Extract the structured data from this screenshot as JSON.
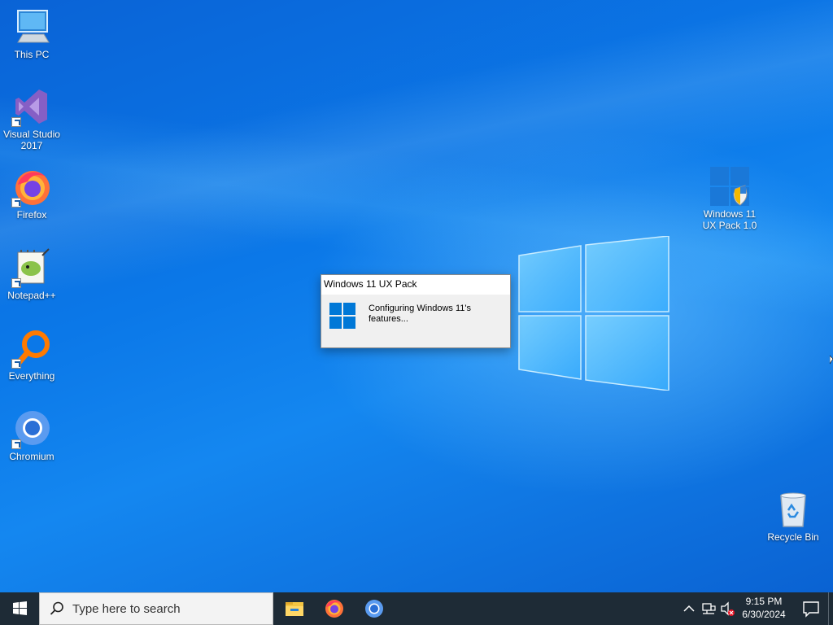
{
  "desktop": {
    "icons_left": [
      {
        "label": "This PC"
      },
      {
        "label": "Visual Studio 2017"
      },
      {
        "label": "Firefox"
      },
      {
        "label": "Notepad++"
      },
      {
        "label": "Everything"
      },
      {
        "label": "Chromium"
      }
    ],
    "icon_ux_pack": {
      "label": "Windows 11 UX Pack 1.0"
    },
    "icon_recycle_bin": {
      "label": "Recycle Bin"
    }
  },
  "dialog": {
    "title": "Windows 11 UX Pack",
    "message": "Configuring Windows 11's features..."
  },
  "taskbar": {
    "search_placeholder": "Type here to search",
    "pinned": [
      {
        "name": "file-explorer"
      },
      {
        "name": "firefox"
      },
      {
        "name": "chromium"
      }
    ],
    "clock": {
      "time": "9:15 PM",
      "date": "6/30/2024"
    }
  },
  "colors": {
    "desktop_blue": "#0b78e8",
    "taskbar": "#1e2b36",
    "windows_blue": "#0078d7"
  }
}
